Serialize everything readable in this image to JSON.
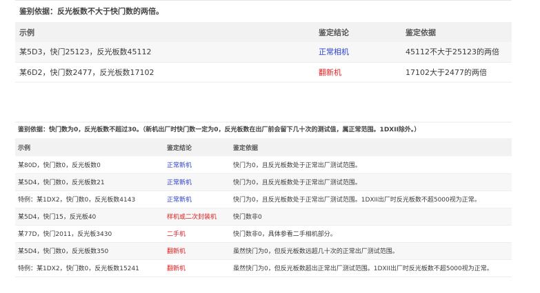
{
  "table1": {
    "caption": "鉴别依据：反光板数不大于快门数的两倍。",
    "headers": [
      "示例",
      "鉴定结论",
      "鉴定依据"
    ],
    "rows": [
      {
        "example": "某5D3，快门25123，反光板数45112",
        "verdict": "正常相机",
        "basis": "45112不大于25123的两倍",
        "color": "#2a3fd0"
      },
      {
        "example": "某6D2，快门数2477，反光板数17102",
        "verdict": "翻新机",
        "basis": "17102大于2477的两倍",
        "color": "#e02020"
      }
    ]
  },
  "table2": {
    "caption": "鉴别依据：快门数为0，反光板数不超过30。（新机出厂时快门数一定为0，反光板数在出厂前会留下几十次的测试值，属正常范围。1DXII除外。）",
    "headers": [
      "示例",
      "鉴定结论",
      "鉴定依据"
    ],
    "rows": [
      {
        "example": "某80D，快门数0，反光板数0",
        "verdict": "正常新机",
        "basis": "快门为0，且反光板数处于正常出厂测试范围。",
        "color": "#2a3fd0"
      },
      {
        "example": "某5D4，快门数0，反光板数21",
        "verdict": "正常新机",
        "basis": "快门为0，且反光板数处于正常出厂测试范围。",
        "color": "#2a3fd0"
      },
      {
        "example": "特例：某1DX2，快门数0，反光板数4143",
        "verdict": "正常新机",
        "basis": "快门为0，且反光板数处于正常出厂测试范围。1DXII出厂时反光板数不超5000视为正常。",
        "color": "#2a3fd0"
      },
      {
        "example": "某5D4，快门15，反光板40",
        "verdict": "样机或二次封装机",
        "basis": "快门数非0",
        "color": "#e02020"
      },
      {
        "example": "某77D，快门2011，反光板3430",
        "verdict": "二手机",
        "basis": "快门数非0，具体参看二手相机部分。",
        "color": "#e02020"
      },
      {
        "example": "某5D4，快门数0，反光板数350",
        "verdict": "翻新机",
        "basis": "虽然快门为0，但反光板数远超几十次的正常出厂测试范围。",
        "color": "#e02020"
      },
      {
        "example": "特例：某1DX2，快门数0，反光板数15241",
        "verdict": "翻新机",
        "basis": "虽然快门为0，但反光板数超出正常出厂测试范围。1DXII出厂时反光板数不超5000视为正常。",
        "color": "#e02020"
      }
    ]
  }
}
